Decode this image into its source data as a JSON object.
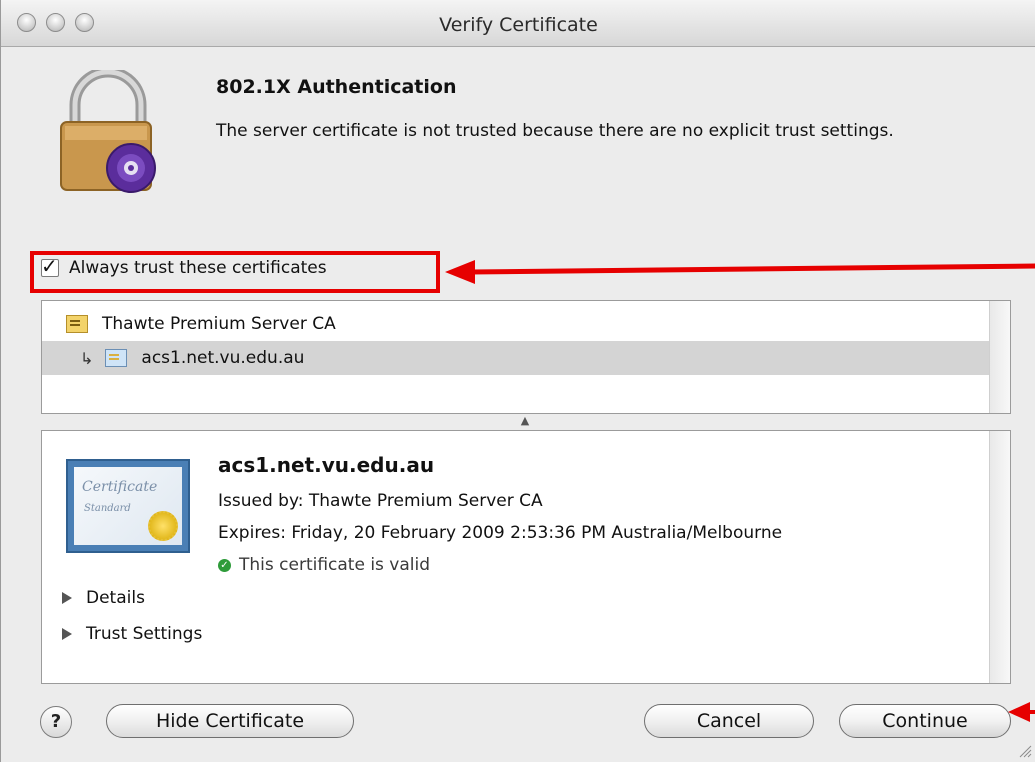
{
  "window": {
    "title": "Verify Certificate"
  },
  "header": {
    "heading": "802.1X Authentication",
    "message": "The server certificate is not trusted because there are no explicit trust settings."
  },
  "trust_checkbox": {
    "label": "Always trust these certificates",
    "checked": true
  },
  "certificate_chain": [
    {
      "label": "Thawte Premium Server CA",
      "icon": "root-certificate-icon",
      "selected": false
    },
    {
      "label": "acs1.net.vu.edu.au",
      "icon": "leaf-certificate-icon",
      "selected": true
    }
  ],
  "certificate_detail": {
    "name": "acs1.net.vu.edu.au",
    "issued_by": "Issued by: Thawte Premium Server CA",
    "expires": "Expires: Friday, 20 February 2009 2:53:36 PM Australia/Melbourne",
    "status": "This certificate is valid",
    "graphic_text_1": "Certificate",
    "graphic_text_2": "Standard",
    "sections": [
      "Details",
      "Trust Settings"
    ]
  },
  "buttons": {
    "help": "?",
    "hide_certificate": "Hide Certificate",
    "cancel": "Cancel",
    "continue": "Continue"
  },
  "colors": {
    "annotation_red": "#e60000",
    "valid_green": "#2e9b3a"
  }
}
